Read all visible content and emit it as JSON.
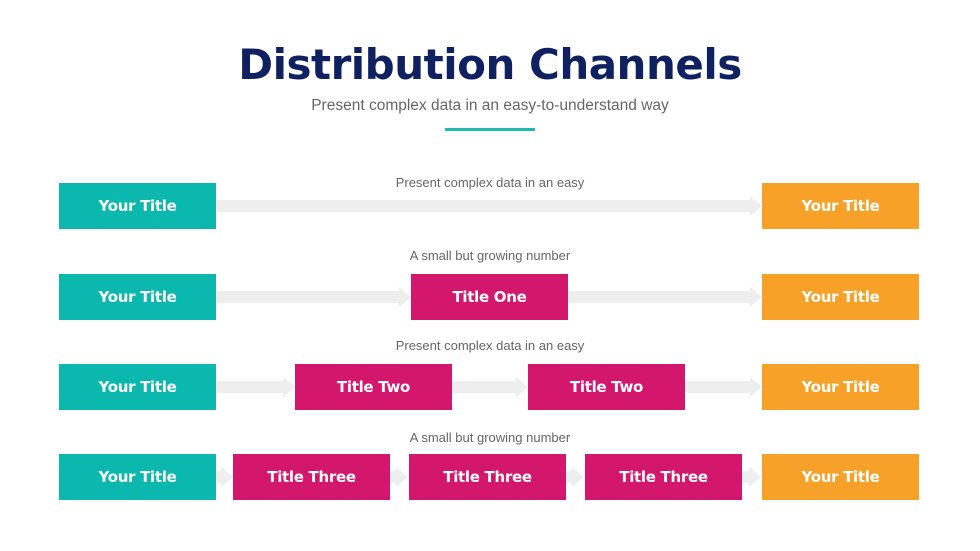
{
  "header": {
    "title": "Distribution Channels",
    "subtitle": "Present complex data in an easy-to-understand way"
  },
  "colors": {
    "start": "#0bb8ae",
    "middle": "#d3176d",
    "end": "#f7a128",
    "arrow": "#eeeeef",
    "title": "#0f2160"
  },
  "rows": [
    {
      "caption": "Present complex data in an easy",
      "start": "Your Title",
      "middle": [],
      "end": "Your Title"
    },
    {
      "caption": "A small but growing number",
      "start": "Your Title",
      "middle": [
        "Title One"
      ],
      "end": "Your Title"
    },
    {
      "caption": "Present complex data in an easy",
      "start": "Your Title",
      "middle": [
        "Title Two",
        "Title Two"
      ],
      "end": "Your Title"
    },
    {
      "caption": "A small but growing number",
      "start": "Your Title",
      "middle": [
        "Title Three",
        "Title Three",
        "Title Three"
      ],
      "end": "Your Title"
    }
  ]
}
